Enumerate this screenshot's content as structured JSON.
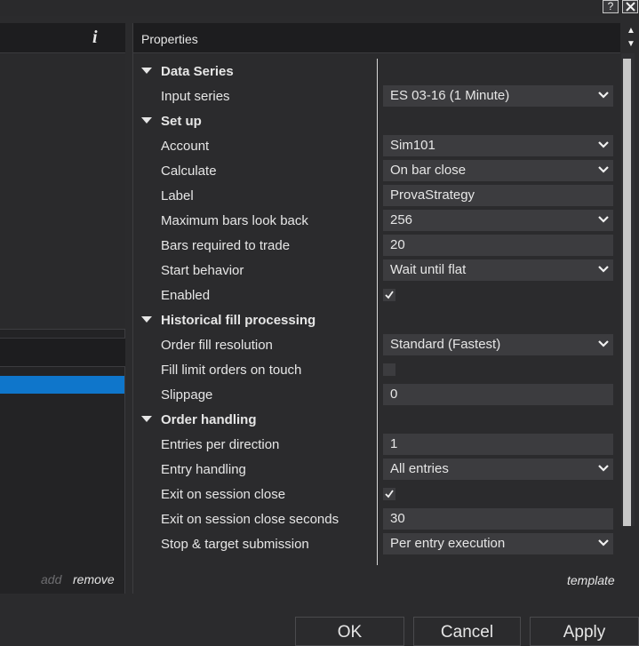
{
  "window": {
    "help_glyph": "?",
    "close_glyph": "x"
  },
  "left_panel": {
    "info_glyph": "i",
    "add_label": "add",
    "remove_label": "remove"
  },
  "properties": {
    "title": "Properties",
    "template_label": "template",
    "rows": [
      {
        "type": "category",
        "label": "Data Series"
      },
      {
        "type": "dropdown",
        "label": "Input series",
        "value": "ES 03-16 (1 Minute)"
      },
      {
        "type": "category",
        "label": "Set up"
      },
      {
        "type": "dropdown",
        "label": "Account",
        "value": "Sim101"
      },
      {
        "type": "dropdown",
        "label": "Calculate",
        "value": "On bar close"
      },
      {
        "type": "text",
        "label": "Label",
        "value": "ProvaStrategy"
      },
      {
        "type": "dropdown",
        "label": "Maximum bars look back",
        "value": "256"
      },
      {
        "type": "text",
        "label": "Bars required to trade",
        "value": "20"
      },
      {
        "type": "dropdown",
        "label": "Start behavior",
        "value": "Wait until flat"
      },
      {
        "type": "checkbox",
        "label": "Enabled",
        "checked": true
      },
      {
        "type": "category",
        "label": "Historical fill processing"
      },
      {
        "type": "dropdown",
        "label": "Order fill resolution",
        "value": "Standard (Fastest)"
      },
      {
        "type": "checkbox",
        "label": "Fill limit orders on touch",
        "checked": false
      },
      {
        "type": "text",
        "label": "Slippage",
        "value": "0"
      },
      {
        "type": "category",
        "label": "Order handling"
      },
      {
        "type": "text",
        "label": "Entries per direction",
        "value": "1"
      },
      {
        "type": "dropdown",
        "label": "Entry handling",
        "value": "All entries"
      },
      {
        "type": "checkbox",
        "label": "Exit on session close",
        "checked": true
      },
      {
        "type": "text",
        "label": "Exit on session close seconds",
        "value": "30"
      },
      {
        "type": "dropdown",
        "label": "Stop & target submission",
        "value": "Per entry execution"
      }
    ]
  },
  "buttons": {
    "ok": "OK",
    "cancel": "Cancel",
    "apply": "Apply"
  },
  "colors": {
    "selection": "#0f76cb",
    "background": "#2b2b2d",
    "header": "#1d1d1f",
    "field": "#3c3c3f"
  }
}
